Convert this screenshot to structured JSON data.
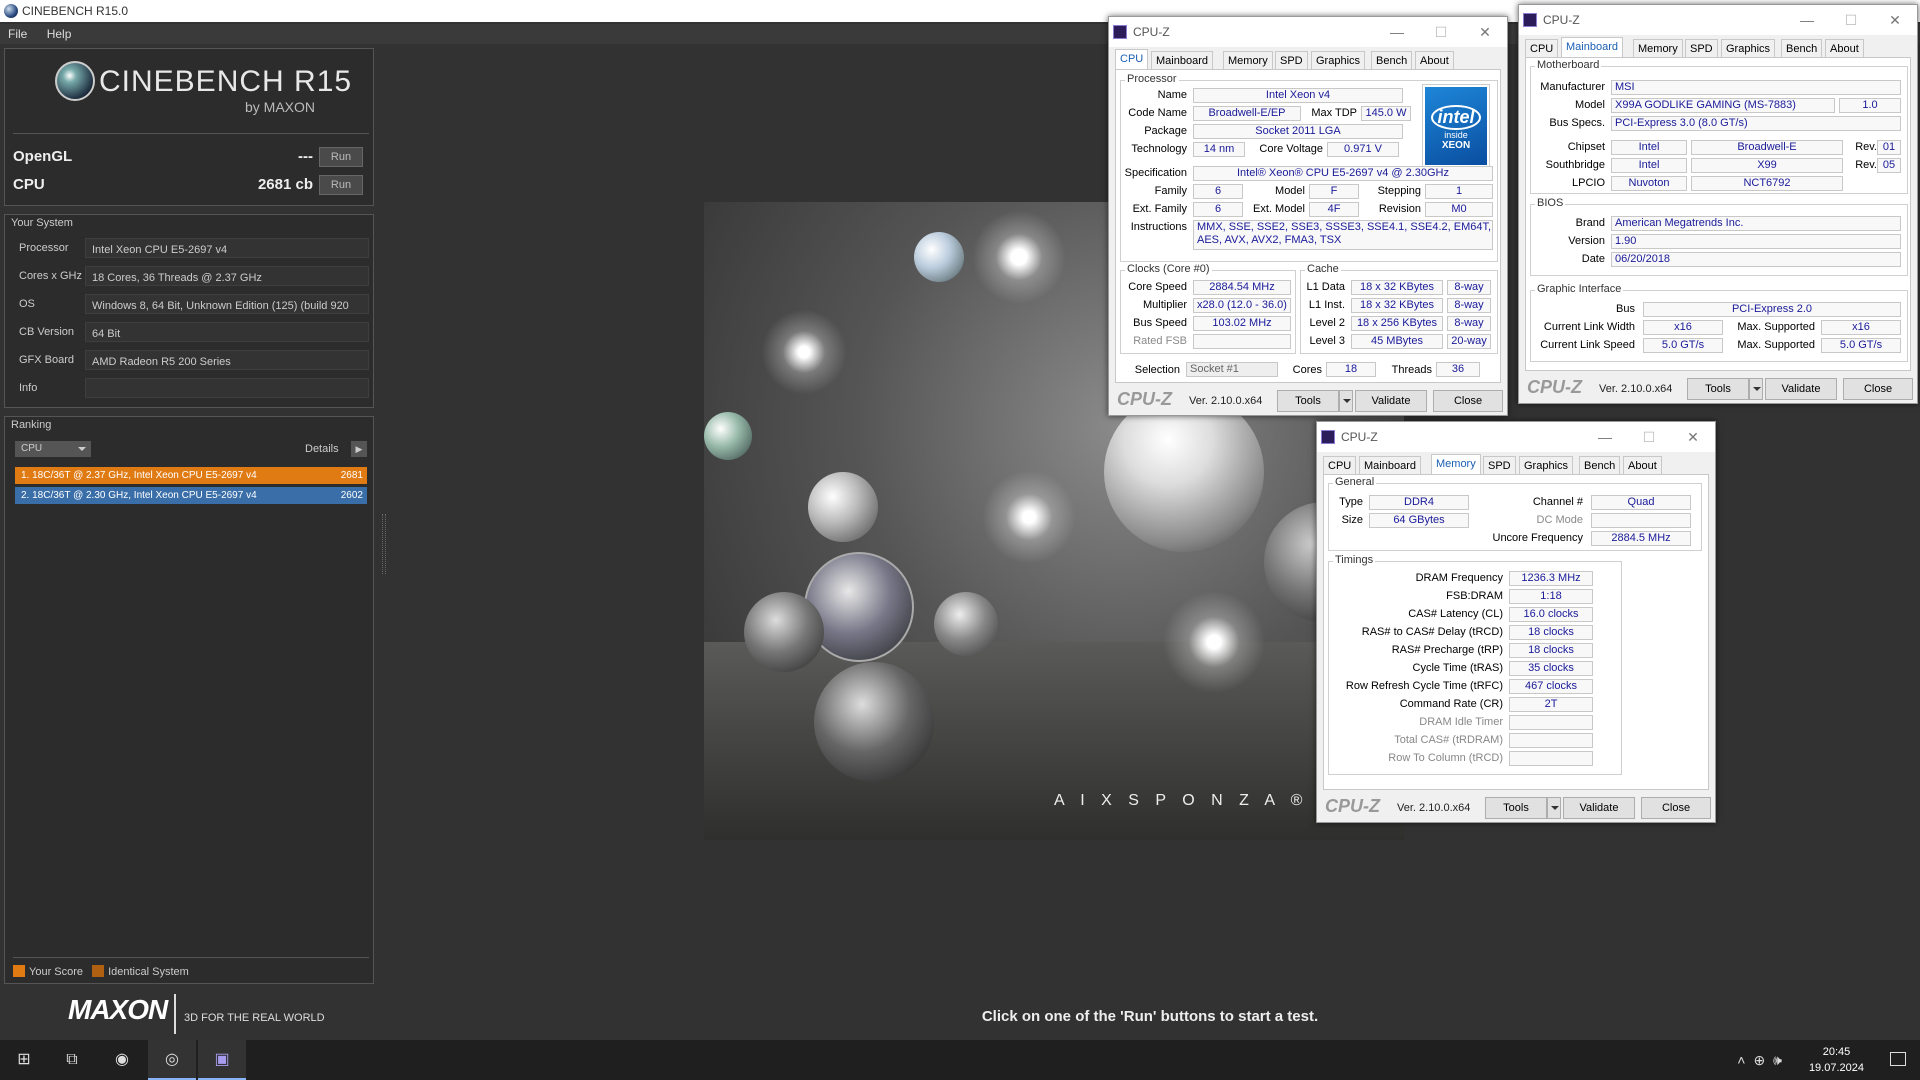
{
  "cinebench": {
    "window_title": "CINEBENCH R15.0",
    "menu": [
      "File",
      "Help"
    ],
    "brand": "CINEBENCH R15",
    "by": "by MAXON",
    "opengl": {
      "label": "OpenGL",
      "value": "---",
      "run": "Run"
    },
    "cpu": {
      "label": "CPU",
      "value": "2681 cb",
      "run": "Run"
    },
    "your_system": {
      "title": "Your System",
      "rows": [
        {
          "label": "Processor",
          "value": "Intel Xeon CPU E5-2697 v4"
        },
        {
          "label": "Cores x GHz",
          "value": "18 Cores, 36 Threads @ 2.37 GHz"
        },
        {
          "label": "OS",
          "value": "Windows 8, 64 Bit, Unknown Edition (125) (build 920"
        },
        {
          "label": "CB Version",
          "value": "64 Bit"
        },
        {
          "label": "GFX Board",
          "value": "AMD Radeon R5 200 Series"
        },
        {
          "label": "Info",
          "value": ""
        }
      ]
    },
    "ranking": {
      "title": "Ranking",
      "selector": "CPU",
      "details": "Details",
      "rows": [
        {
          "text": "1. 18C/36T @ 2.37 GHz, Intel Xeon CPU E5-2697 v4",
          "score": "2681",
          "color": "#e07b14"
        },
        {
          "text": "2. 18C/36T @ 2.30 GHz, Intel Xeon CPU E5-2697 v4",
          "score": "2602",
          "color": "#3a6ea8"
        }
      ]
    },
    "legend": {
      "your_score": "Your Score",
      "identical": "Identical System",
      "your_color": "#e07b14",
      "identical_color": "#b06010"
    },
    "maxon": "MAXON",
    "tagline": "3D FOR THE REAL WORLD",
    "status": "Click on one of the 'Run' buttons to start a test.",
    "render_logo": "A I X S P O N Z A ®"
  },
  "cpuz_tabs": [
    "CPU",
    "Mainboard",
    "Memory",
    "SPD",
    "Graphics",
    "Bench",
    "About"
  ],
  "cpuz_common": {
    "title": "CPU-Z",
    "logo": "CPU-Z",
    "version": "Ver. 2.10.0.x64",
    "tools": "Tools",
    "validate": "Validate",
    "close": "Close"
  },
  "cpuz_cpu": {
    "processor_group": "Processor",
    "name": {
      "label": "Name",
      "value": "Intel Xeon v4"
    },
    "code_name": {
      "label": "Code Name",
      "value": "Broadwell-E/EP"
    },
    "max_tdp": {
      "label": "Max TDP",
      "value": "145.0 W"
    },
    "package": {
      "label": "Package",
      "value": "Socket 2011 LGA"
    },
    "technology": {
      "label": "Technology",
      "value": "14 nm"
    },
    "core_voltage": {
      "label": "Core Voltage",
      "value": "0.971 V"
    },
    "specification": {
      "label": "Specification",
      "value": "Intel® Xeon® CPU E5-2697 v4 @ 2.30GHz"
    },
    "family": {
      "label": "Family",
      "value": "6"
    },
    "model": {
      "label": "Model",
      "value": "F"
    },
    "stepping": {
      "label": "Stepping",
      "value": "1"
    },
    "ext_family": {
      "label": "Ext. Family",
      "value": "6"
    },
    "ext_model": {
      "label": "Ext. Model",
      "value": "4F"
    },
    "revision": {
      "label": "Revision",
      "value": "M0"
    },
    "instructions": {
      "label": "Instructions",
      "line1": "MMX, SSE, SSE2, SSE3, SSSE3, SSE4.1, SSE4.2, EM64T, VT-x,",
      "line2": "AES, AVX, AVX2, FMA3, TSX"
    },
    "clocks_group": "Clocks (Core #0)",
    "core_speed": {
      "label": "Core Speed",
      "value": "2884.54 MHz"
    },
    "multiplier": {
      "label": "Multiplier",
      "value": "x28.0 (12.0 - 36.0)"
    },
    "bus_speed": {
      "label": "Bus Speed",
      "value": "103.02 MHz"
    },
    "rated_fsb": {
      "label": "Rated FSB",
      "value": ""
    },
    "cache_group": "Cache",
    "l1d": {
      "label": "L1 Data",
      "value": "18 x 32 KBytes",
      "way": "8-way"
    },
    "l1i": {
      "label": "L1 Inst.",
      "value": "18 x 32 KBytes",
      "way": "8-way"
    },
    "l2": {
      "label": "Level 2",
      "value": "18 x 256 KBytes",
      "way": "8-way"
    },
    "l3": {
      "label": "Level 3",
      "value": "45 MBytes",
      "way": "20-way"
    },
    "selection": {
      "label": "Selection",
      "value": "Socket #1"
    },
    "cores": {
      "label": "Cores",
      "value": "18"
    },
    "threads": {
      "label": "Threads",
      "value": "36"
    },
    "intel_badge": {
      "brand": "intel",
      "inside": "inside",
      "line": "XEON"
    }
  },
  "cpuz_mb": {
    "motherboard_group": "Motherboard",
    "manufacturer": {
      "label": "Manufacturer",
      "value": "MSI"
    },
    "model": {
      "label": "Model",
      "value": "X99A GODLIKE GAMING (MS-7883)",
      "rev": "1.0"
    },
    "bus_specs": {
      "label": "Bus Specs.",
      "value": "PCI-Express 3.0 (8.0 GT/s)"
    },
    "chipset": {
      "label": "Chipset",
      "v1": "Intel",
      "v2": "Broadwell-E",
      "rev_label": "Rev.",
      "rev": "01"
    },
    "southbridge": {
      "label": "Southbridge",
      "v1": "Intel",
      "v2": "X99",
      "rev_label": "Rev.",
      "rev": "05"
    },
    "lpcio": {
      "label": "LPCIO",
      "v1": "Nuvoton",
      "v2": "NCT6792"
    },
    "bios_group": "BIOS",
    "brand": {
      "label": "Brand",
      "value": "American Megatrends Inc."
    },
    "version": {
      "label": "Version",
      "value": "1.90"
    },
    "date": {
      "label": "Date",
      "value": "06/20/2018"
    },
    "gi_group": "Graphic Interface",
    "bus": {
      "label": "Bus",
      "value": "PCI-Express 2.0"
    },
    "link_width": {
      "label": "Current Link Width",
      "value": "x16",
      "max_label": "Max. Supported",
      "max": "x16"
    },
    "link_speed": {
      "label": "Current Link Speed",
      "value": "5.0 GT/s",
      "max_label": "Max. Supported",
      "max": "5.0 GT/s"
    }
  },
  "cpuz_mem": {
    "general_group": "General",
    "type": {
      "label": "Type",
      "value": "DDR4"
    },
    "channel": {
      "label": "Channel #",
      "value": "Quad"
    },
    "size": {
      "label": "Size",
      "value": "64 GBytes"
    },
    "dc_mode": {
      "label": "DC Mode",
      "value": ""
    },
    "uncore": {
      "label": "Uncore Frequency",
      "value": "2884.5 MHz"
    },
    "timings_group": "Timings",
    "timings": [
      {
        "label": "DRAM Frequency",
        "value": "1236.3 MHz",
        "dis": false
      },
      {
        "label": "FSB:DRAM",
        "value": "1:18",
        "dis": false
      },
      {
        "label": "CAS# Latency (CL)",
        "value": "16.0 clocks",
        "dis": false
      },
      {
        "label": "RAS# to CAS# Delay (tRCD)",
        "value": "18 clocks",
        "dis": false
      },
      {
        "label": "RAS# Precharge (tRP)",
        "value": "18 clocks",
        "dis": false
      },
      {
        "label": "Cycle Time (tRAS)",
        "value": "35 clocks",
        "dis": false
      },
      {
        "label": "Row Refresh Cycle Time (tRFC)",
        "value": "467 clocks",
        "dis": false
      },
      {
        "label": "Command Rate (CR)",
        "value": "2T",
        "dis": false
      },
      {
        "label": "DRAM Idle Timer",
        "value": "",
        "dis": true
      },
      {
        "label": "Total CAS# (tRDRAM)",
        "value": "",
        "dis": true
      },
      {
        "label": "Row To Column (tRCD)",
        "value": "",
        "dis": true
      }
    ]
  },
  "taskbar": {
    "time": "20:45",
    "date": "19.07.2024"
  }
}
